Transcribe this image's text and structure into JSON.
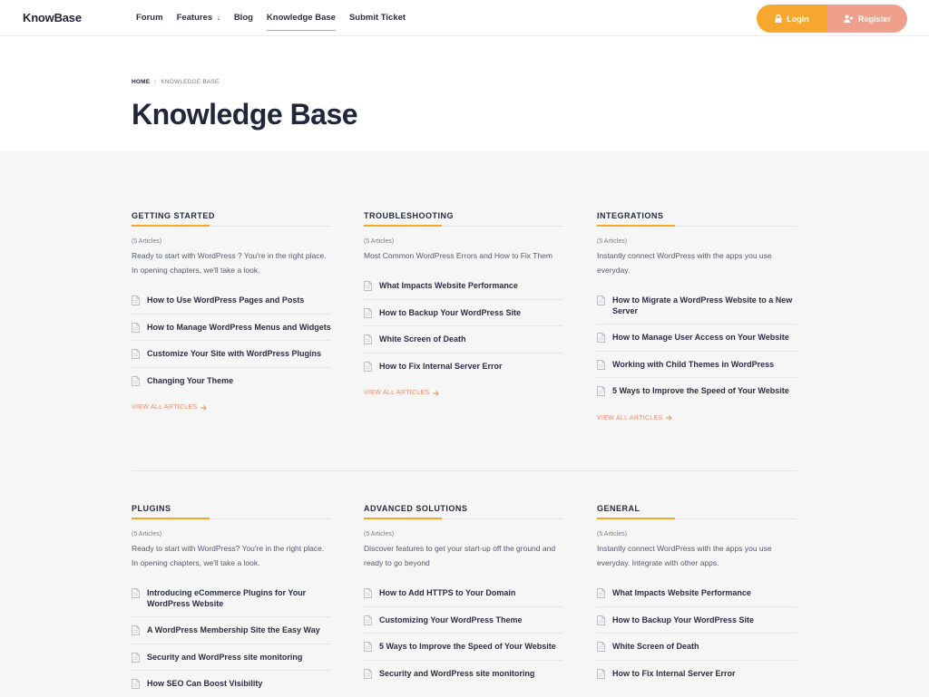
{
  "header": {
    "logo": "KnowBase",
    "nav": [
      {
        "label": "Forum"
      },
      {
        "label": "Features",
        "arrow": "↓"
      },
      {
        "label": "Blog"
      },
      {
        "label": "Knowledge Base"
      },
      {
        "label": "Submit Ticket"
      }
    ],
    "login_label": "Login",
    "register_label": "Register"
  },
  "breadcrumb": {
    "home": "HOME",
    "separator": "/",
    "current": "KNOWLEDGE BASE"
  },
  "page_title": "Knowledge Base",
  "view_all_label": "VIEW ALL ARTICLES",
  "categories": [
    {
      "title": "GETTING STARTED",
      "count": "(5 Articles)",
      "description": "Ready to start with WordPress ? You're in the right place. In opening chapters, we'll take a look.",
      "articles": [
        "How to Use WordPress Pages and Posts",
        "How to Manage WordPress Menus and Widgets",
        "Customize Your Site with WordPress Plugins",
        "Changing Your Theme"
      ]
    },
    {
      "title": "TROUBLESHOOTING",
      "count": "(5 Articles)",
      "description": "Most Common WordPress Errors and How to Fix Them",
      "articles": [
        "What Impacts Website Performance",
        "How to Backup Your WordPress Site",
        "White Screen of Death",
        "How to Fix Internal Server Error"
      ]
    },
    {
      "title": "INTEGRATIONS",
      "count": "(5 Articles)",
      "description": "Instantly connect WordPress with the apps you use everyday.",
      "articles": [
        "How to Migrate a WordPress Website to a New Server",
        "How to Manage User Access on Your Website",
        "Working with Child Themes in WordPress",
        "5 Ways to Improve the Speed of Your Website"
      ]
    },
    {
      "title": "PLUGINS",
      "count": "(5 Articles)",
      "description": "Ready to start with WordPress? You're in the right place. In opening chapters, we'll take a look.",
      "articles": [
        "Introducing eCommerce Plugins for Your WordPress Website",
        "A WordPress Membership Site the Easy Way",
        "Security and WordPress site monitoring",
        "How SEO Can Boost Visibility"
      ]
    },
    {
      "title": "ADVANCED SOLUTIONS",
      "count": "(5 Articles)",
      "description": "Discover features to get your start-up off the ground and ready to go beyond",
      "articles": [
        "How to Add HTTPS to Your Domain",
        "Customizing Your WordPress Theme",
        "5 Ways to Improve the Speed of Your Website",
        "Security and WordPress site monitoring"
      ]
    },
    {
      "title": "GENERAL",
      "count": "(5 Articles)",
      "description": "Instantly connect WordPress with the apps you use everyday. Integrate with other apps.",
      "articles": [
        "What Impacts Website Performance",
        "How to Backup Your WordPress Site",
        "White Screen of Death",
        "How to Fix Internal Server Error"
      ]
    }
  ],
  "colors": {
    "accent": "#f5a623",
    "login_bg": "#f7a72e",
    "register_bg": "#eea08d",
    "link": "#f08a6a",
    "text_dark": "#22263a"
  },
  "icons": {
    "login": "lock-icon",
    "register": "user-plus-icon",
    "article": "document-icon",
    "view_all": "arrow-right-icon"
  }
}
